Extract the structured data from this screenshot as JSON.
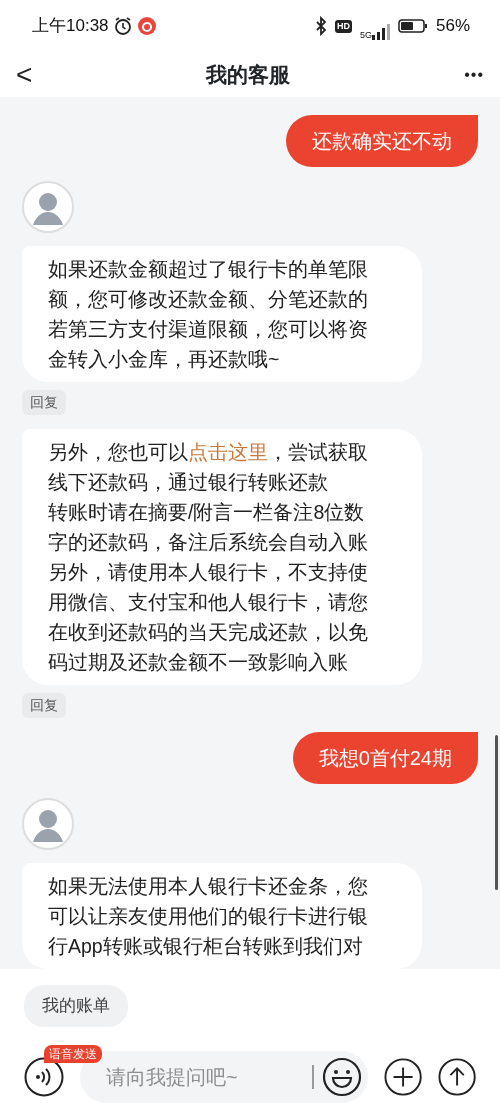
{
  "status_bar": {
    "time": "上午10:38",
    "hd": "HD",
    "network": "5G",
    "battery": "56%"
  },
  "header": {
    "back": "<",
    "title": "我的客服",
    "more": "•••"
  },
  "messages": [
    {
      "kind": "user",
      "lines": [
        "还款确实还不动"
      ]
    },
    {
      "kind": "bot",
      "avatar": true,
      "lines": [
        "如果还款金额超过了银行卡的单笔限",
        "额，您可修改还款金额、分笔还款的",
        "若第三方支付渠道限额，您可以将资",
        "金转入小金库，再还款哦~"
      ],
      "reply": "回复"
    },
    {
      "kind": "bot",
      "avatar": false,
      "lines": [
        [
          {
            "text": "另外，您也可以"
          },
          {
            "text": "点击这里",
            "link": true
          },
          {
            "text": "，尝试获取"
          }
        ],
        "线下还款码，通过银行转账还款",
        "转账时请在摘要/附言一栏备注8位数",
        "字的还款码，备注后系统会自动入账",
        "另外，请使用本人银行卡，不支持使",
        "用微信、支付宝和他人银行卡，请您",
        "在收到还款码的当天完成还款，以免",
        "码过期及还款金额不一致影响入账"
      ],
      "reply": "回复"
    },
    {
      "kind": "user",
      "lines": [
        "我想0首付24期"
      ]
    },
    {
      "kind": "bot",
      "avatar": true,
      "lines": [
        "如果无法使用本人银行卡还金条，您",
        "可以让亲友使用他们的银行卡进行银",
        "行App转账或银行柜台转账到我们对"
      ]
    }
  ],
  "quick_replies": [
    "我的账单"
  ],
  "composer": {
    "voice_badge": "语音发送",
    "placeholder": "请向我提问吧~"
  }
}
